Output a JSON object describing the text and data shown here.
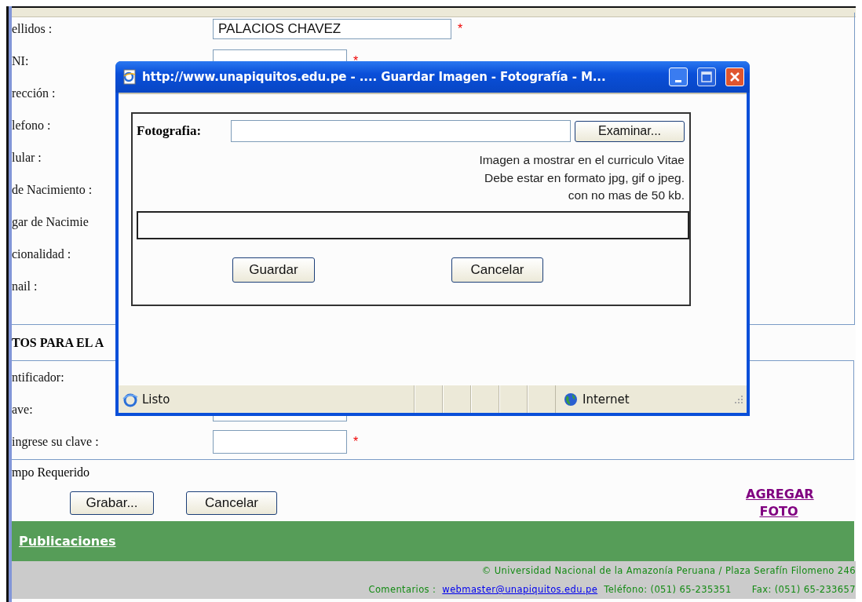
{
  "browser_page": {
    "section_personal": {
      "rows": [
        {
          "label": "ellidos :",
          "kind": "wide",
          "value": "PALACIOS CHAVEZ",
          "required_mark": "*"
        },
        {
          "label": "NI:",
          "kind": "narrow",
          "required_mark": "*"
        },
        {
          "label": "rección :",
          "kind": "none"
        },
        {
          "label": "lefono :",
          "kind": "none"
        },
        {
          "label": "lular :",
          "kind": "none"
        },
        {
          "label": "de Nacimiento :",
          "kind": "none"
        },
        {
          "label": "gar de Nacimie",
          "kind": "none"
        },
        {
          "label": "cionalidad :",
          "kind": "none"
        },
        {
          "label": "nail :",
          "kind": "none"
        }
      ]
    },
    "section_access": {
      "heading": "TOS PARA EL A",
      "rows": [
        {
          "label": "ntificador:",
          "kind": "none"
        },
        {
          "label": "ave:",
          "kind": "narrow"
        },
        {
          "label": "ingrese su clave :",
          "kind": "narrow",
          "required_mark": "*"
        }
      ]
    },
    "required_note": "mpo Requerido",
    "buttons": [
      "Grabar...",
      "Cancelar"
    ],
    "add_photo_link": "AGREGAR FOTO",
    "nav_bar": {
      "link": "Publicaciones"
    },
    "footer": {
      "copyright": "© Universidad Nacional de la Amazonía Peruana / Plaza Serafín Filomeno 246",
      "comments_label": "Comentarios :",
      "email": "webmaster@unapiquitos.edu.pe",
      "phone": "Teléfono: (051) 65-235351",
      "fax": "Fax: (051) 65-233657"
    }
  },
  "popup": {
    "title": "http://www.unapiquitos.edu.pe - .... Guardar Imagen - Fotografía - M...",
    "photo_label": "Fotografia:",
    "browse_button": "Examinar...",
    "hint_lines": [
      "Imagen a mostrar en el curriculo Vitae",
      "Debe estar en formato jpg, gif o jpeg.",
      "con no mas de 50 kb."
    ],
    "buttons": [
      "Guardar",
      "Cancelar"
    ],
    "status_bar": {
      "text": "Listo",
      "zone": "Internet"
    }
  }
}
